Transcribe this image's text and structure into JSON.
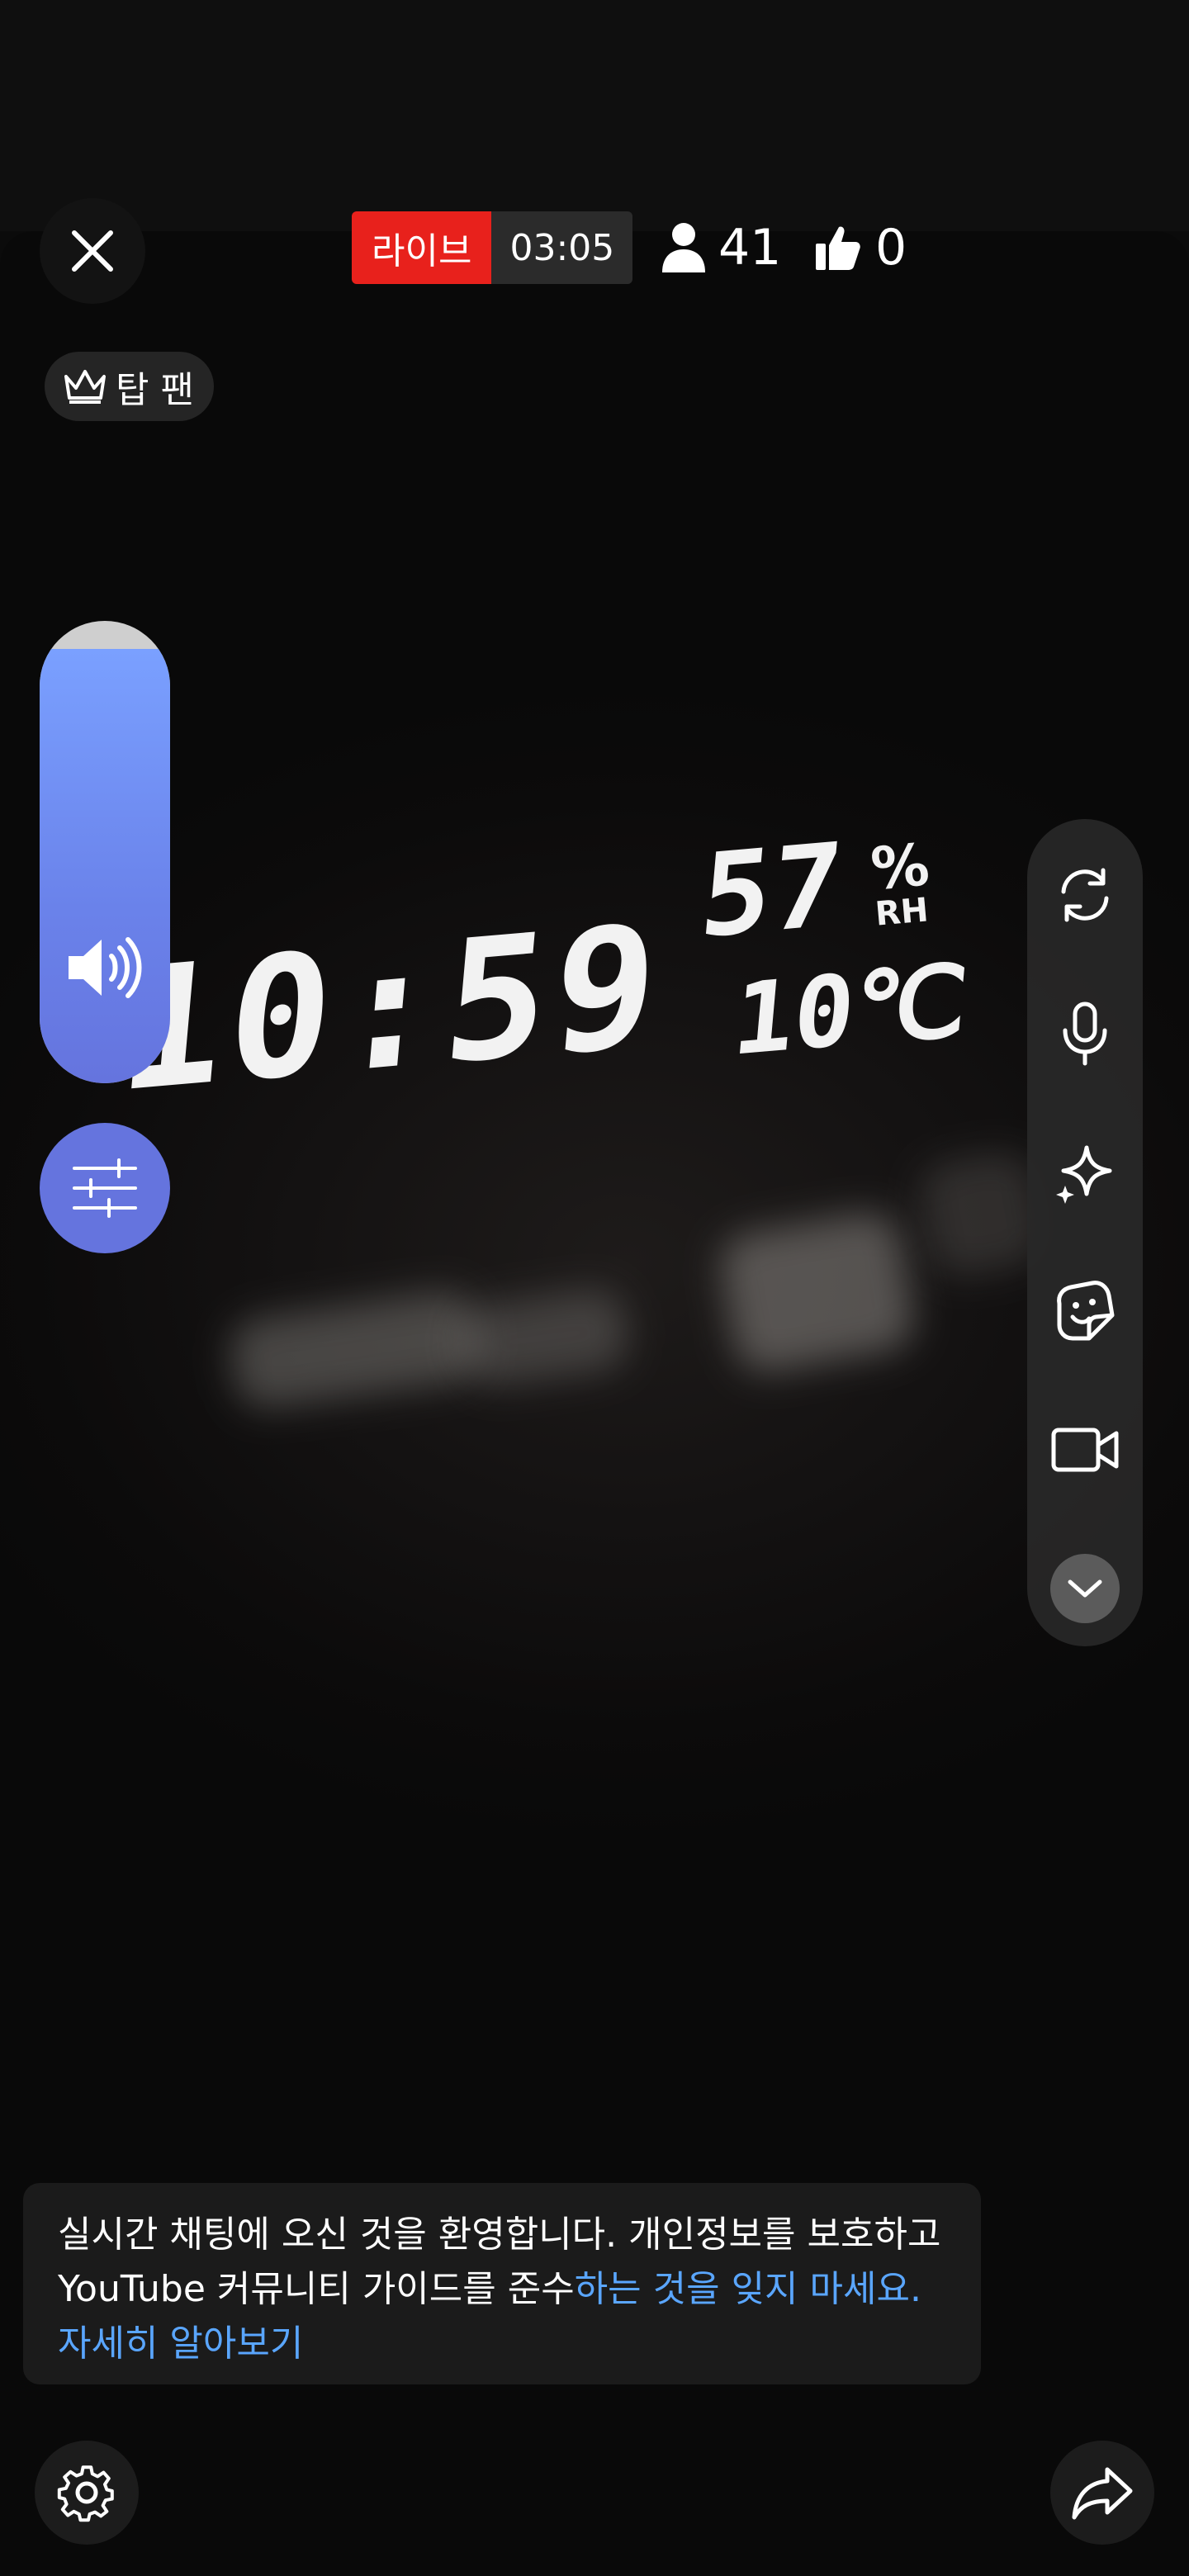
{
  "header": {
    "live_label": "라이브",
    "live_timer": "03:05",
    "viewer_count": "41",
    "like_count": "0"
  },
  "top_fan_label": "탑 팬",
  "camera_scene": {
    "clock": "10:59",
    "humidity": "57",
    "humidity_unit": "%",
    "humidity_suffix": "RH",
    "temperature": "10℃"
  },
  "volume": {
    "level": 0.94
  },
  "icons": {
    "close": "close-icon",
    "viewers": "person-icon",
    "likes": "thumbs-up-icon",
    "top_fan": "crown-icon",
    "volume": "speaker-icon",
    "filters": "sliders-icon",
    "flip_camera": "camera-flip-icon",
    "microphone": "microphone-icon",
    "effects": "sparkle-icon",
    "stickers": "sticker-icon",
    "video": "video-camera-icon",
    "more": "chevron-down-icon",
    "settings": "gear-icon",
    "share": "share-arrow-icon"
  },
  "chat_banner": {
    "text_plain": "실시간 채팅에 오신 것을 환영합니다. 개인정보를 보호하고 YouTube 커뮤니티 가이드를 준수",
    "text_link": "하는 것을 잊지 마세요. 자세히 알아보기"
  },
  "colors": {
    "live_red": "#e8211c",
    "accent_blue": "#6574de",
    "link_blue": "#5aa6ff"
  }
}
